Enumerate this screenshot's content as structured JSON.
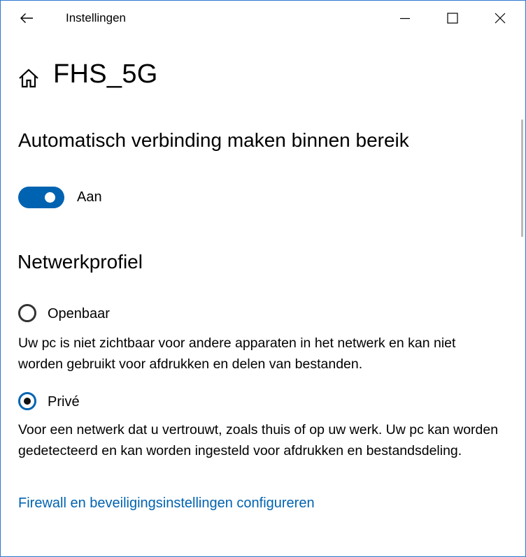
{
  "window": {
    "title": "Instellingen",
    "icons": {
      "back": "back-arrow-icon",
      "minimize": "minimize-icon",
      "maximize": "maximize-icon",
      "close": "close-icon",
      "home": "home-icon"
    },
    "accent_color": "#0063b1"
  },
  "header": {
    "network_name": "FHS_5G"
  },
  "auto_connect": {
    "heading": "Automatisch verbinding maken binnen bereik",
    "toggle_state": "on",
    "toggle_label": "Aan"
  },
  "network_profile": {
    "heading": "Netwerkprofiel",
    "selected": "private",
    "options": [
      {
        "id": "public",
        "label": "Openbaar",
        "description": "Uw pc is niet zichtbaar voor andere apparaten in het netwerk en kan niet worden gebruikt voor afdrukken en delen van bestanden."
      },
      {
        "id": "private",
        "label": "Privé",
        "description": "Voor een netwerk dat u vertrouwt, zoals thuis of op uw werk. Uw pc kan worden gedetecteerd en kan worden ingesteld voor afdrukken en bestandsdeling."
      }
    ]
  },
  "firewall_link": {
    "label": "Firewall en beveiligingsinstellingen configureren"
  }
}
